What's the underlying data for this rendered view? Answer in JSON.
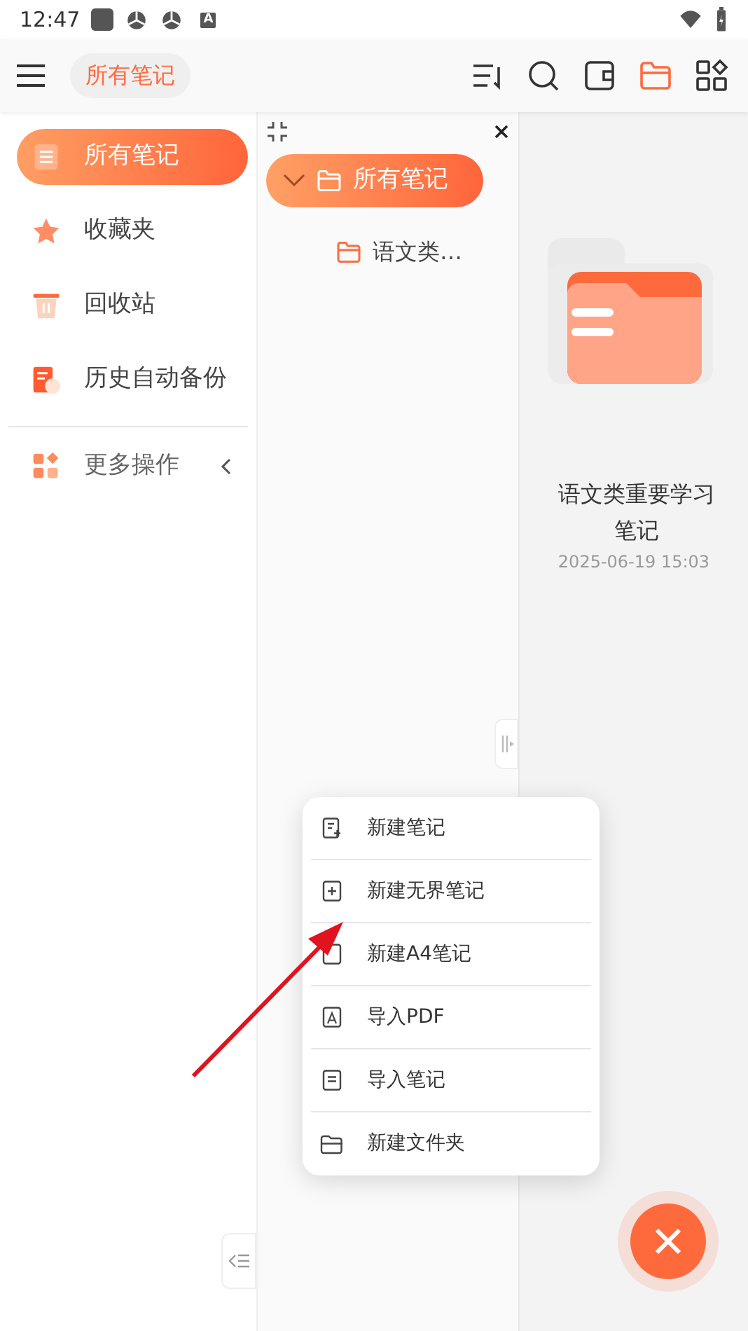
{
  "status_bar": {
    "time": "12:47",
    "badge": "A"
  },
  "toolbar": {
    "title": "所有笔记",
    "icons": [
      {
        "kind": "sort",
        "selected": false
      },
      {
        "kind": "search",
        "selected": false
      },
      {
        "kind": "wallet",
        "selected": false
      },
      {
        "kind": "folder",
        "selected": true
      },
      {
        "kind": "apps",
        "selected": false
      }
    ]
  },
  "sidebar": {
    "items": [
      {
        "kind": "notes",
        "label": "所有笔记",
        "selected": true
      },
      {
        "kind": "star",
        "label": "收藏夹",
        "selected": false
      },
      {
        "kind": "trash",
        "label": "回收站",
        "selected": false
      },
      {
        "kind": "backup",
        "label": "历史自动备份",
        "selected": false
      }
    ],
    "more": {
      "label": "更多操作",
      "expanded": false
    }
  },
  "tree": {
    "root": {
      "label": "所有笔记",
      "expanded": true,
      "selected": true,
      "children": [
        {
          "label": "语文类…",
          "selected": false
        }
      ]
    }
  },
  "note_card": {
    "title": "语文类重要学习笔记",
    "date": "2025-06-19 15:03"
  },
  "menu": [
    {
      "kind": "note",
      "label": "新建笔记"
    },
    {
      "kind": "plus",
      "label": "新建无界笔记"
    },
    {
      "kind": "a4",
      "label": "新建A4笔记"
    },
    {
      "kind": "pdf",
      "label": "导入PDF"
    },
    {
      "kind": "import",
      "label": "导入笔记"
    },
    {
      "kind": "folder",
      "label": "新建文件夹"
    }
  ],
  "fab": {
    "kind": "close"
  }
}
